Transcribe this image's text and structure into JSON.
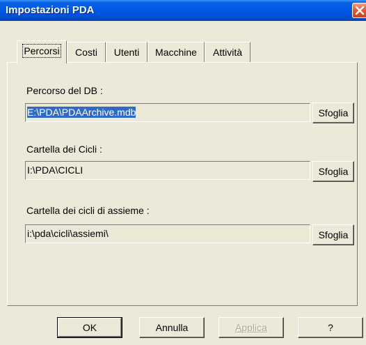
{
  "window": {
    "title": "Impostazioni PDA"
  },
  "tabs": [
    {
      "label": "Percorsi",
      "active": true
    },
    {
      "label": "Costi",
      "active": false
    },
    {
      "label": "Utenti",
      "active": false
    },
    {
      "label": "Macchine",
      "active": false
    },
    {
      "label": "Attività",
      "active": false
    }
  ],
  "fields": {
    "db_path": {
      "label": "Percorso del DB :",
      "value": "E:\\PDA\\PDAArchive.mdb",
      "button": "Sfoglia"
    },
    "cycles_folder": {
      "label": "Cartella dei Cicli :",
      "value": "I:\\PDA\\CICLI",
      "button": "Sfoglia"
    },
    "assembly_cycles_folder": {
      "label": "Cartella dei cicli di assieme :",
      "value": "i:\\pda\\cicli\\assiemi\\",
      "button": "Sfoglia"
    }
  },
  "buttons": {
    "ok": "OK",
    "cancel": "Annulla",
    "apply": "Applica",
    "help": "?"
  },
  "colors": {
    "titlebar": "#0058e6",
    "face": "#ece9d8",
    "selection": "#316ac5"
  }
}
